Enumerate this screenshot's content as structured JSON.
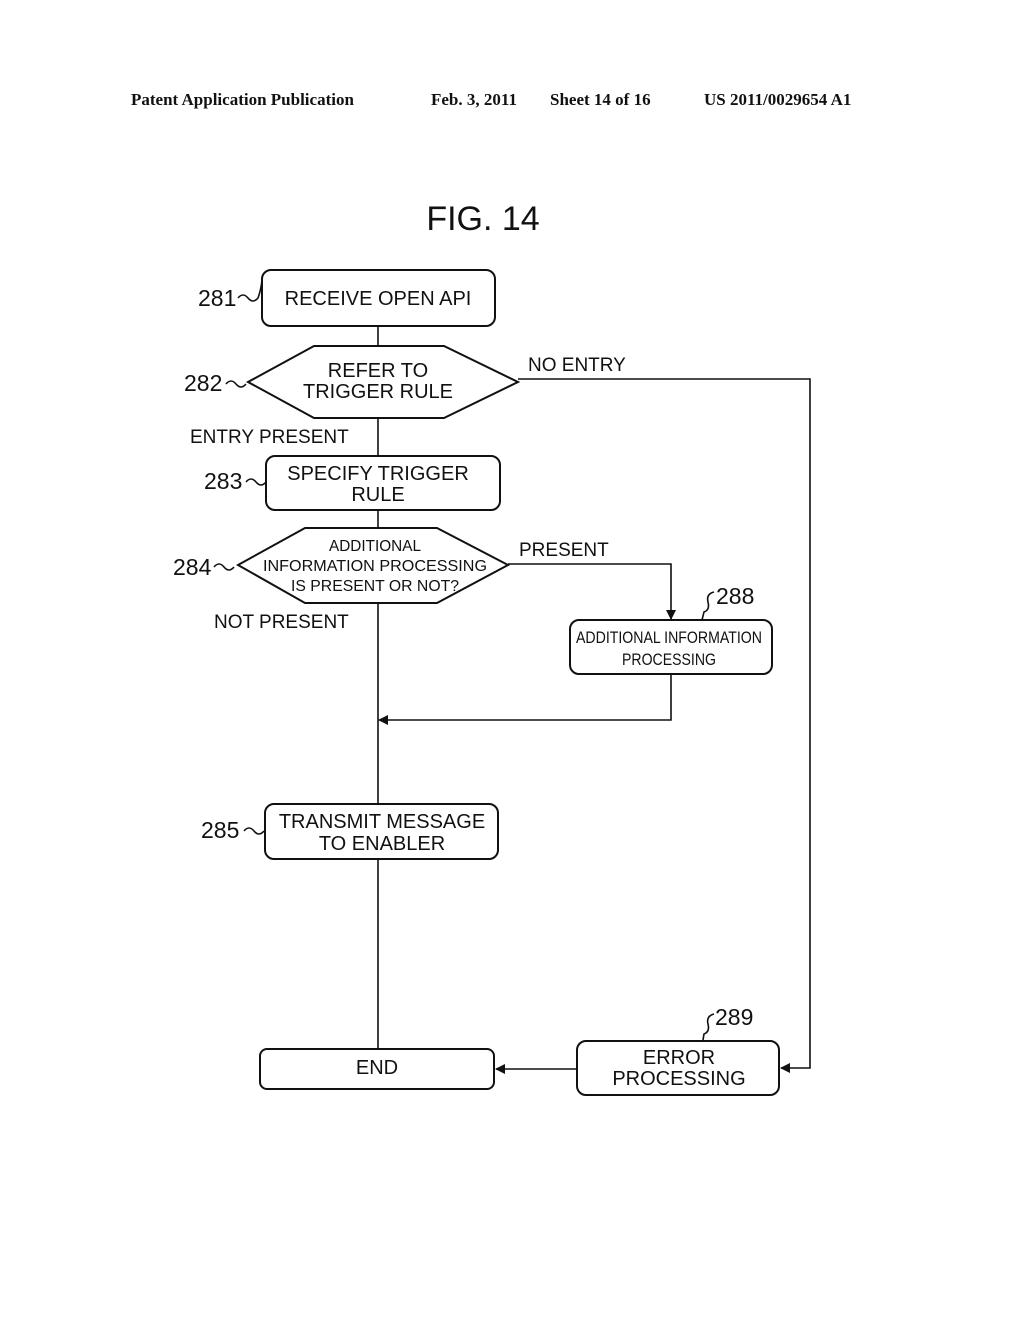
{
  "header": {
    "publication": "Patent Application Publication",
    "date": "Feb. 3, 2011",
    "sheet": "Sheet 14 of 16",
    "number": "US 2011/0029654 A1"
  },
  "figure_title": "FIG. 14",
  "nodes": {
    "n281": {
      "ref": "281",
      "lines": [
        "RECEIVE OPEN API"
      ]
    },
    "n282": {
      "ref": "282",
      "lines": [
        "REFER TO",
        "TRIGGER RULE"
      ]
    },
    "n283": {
      "ref": "283",
      "lines": [
        "SPECIFY TRIGGER",
        "RULE"
      ]
    },
    "n284": {
      "ref": "284",
      "lines": [
        "ADDITIONAL",
        "INFORMATION PROCESSING",
        "IS PRESENT OR NOT?"
      ]
    },
    "n285": {
      "ref": "285",
      "lines": [
        "TRANSMIT MESSAGE",
        "TO ENABLER"
      ]
    },
    "n288": {
      "ref": "288",
      "lines": [
        "ADDITIONAL INFORMATION",
        "PROCESSING"
      ]
    },
    "n289": {
      "ref": "289",
      "lines": [
        "ERROR",
        "PROCESSING"
      ]
    },
    "end": {
      "lines": [
        "END"
      ]
    }
  },
  "edge_labels": {
    "no_entry": "NO ENTRY",
    "entry_present": "ENTRY PRESENT",
    "present": "PRESENT",
    "not_present": "NOT PRESENT"
  }
}
